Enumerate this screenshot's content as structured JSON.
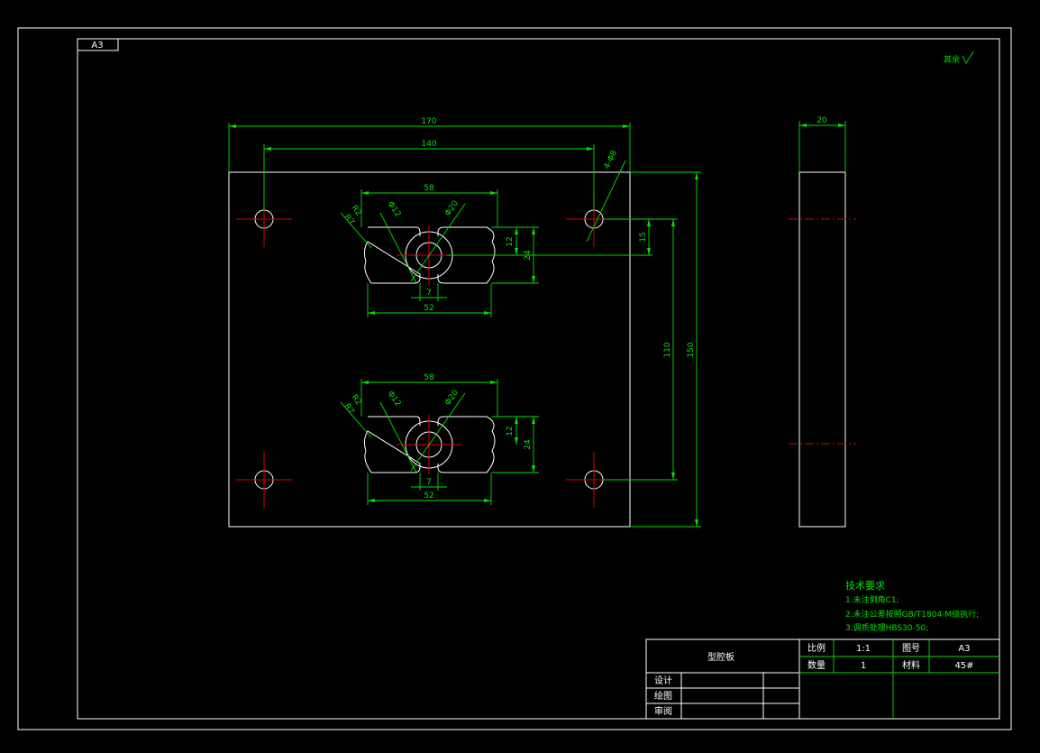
{
  "sheet": {
    "format_label": "A3",
    "roughness_note": "其余"
  },
  "front_view": {
    "dim_width_outer": "170",
    "dim_hole_spacing": "140",
    "dim_hole_note": "4-Φ8",
    "dim_height_total": "150",
    "dim_hole_vertical": "110",
    "dim_offset": "15",
    "slot_top": {
      "width_top": "58",
      "width_bottom": "52",
      "slot": "7",
      "h12": "12",
      "h24": "24",
      "r2": "R2",
      "r7": "R7",
      "d12": "Φ12",
      "d20": "Φ20"
    },
    "slot_bottom": {
      "width_top": "58",
      "width_bottom": "52",
      "slot": "7",
      "h12": "12",
      "h24": "24",
      "r2": "R2",
      "r7": "R7",
      "d12": "Φ12",
      "d20": "Φ20"
    }
  },
  "side_view": {
    "dim_thickness": "20"
  },
  "tech_requirements": {
    "title": "技术要求",
    "items": [
      "1.未注倒角C1;",
      "2.未注公差按照GB/T1804-M级执行;",
      "3.调质处理HBS30-50;"
    ]
  },
  "title_block": {
    "part_name": "型腔板",
    "scale_label": "比例",
    "scale_value": "1:1",
    "drawing_no_label": "图号",
    "drawing_no_value": "A3",
    "qty_label": "数量",
    "qty_value": "1",
    "material_label": "材料",
    "material_value": "45#",
    "design_label": "设计",
    "draw_label": "绘图",
    "review_label": "审阅"
  },
  "colors": {
    "outline": "#ffffff",
    "dimension": "#00e000",
    "centerline": "#e00000",
    "background": "#000000"
  }
}
